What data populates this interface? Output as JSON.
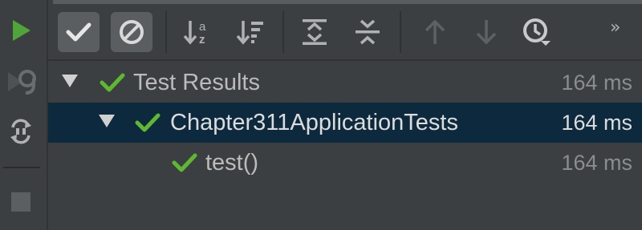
{
  "colors": {
    "background": "#3c3f41",
    "selected_row": "#0d293e",
    "pass_green": "#5fb832",
    "run_green": "#4fa53a",
    "icon_gray": "#afb1b3",
    "muted_text": "#8a8c8e"
  },
  "left_toolbar": {
    "items": [
      {
        "name": "run-icon"
      },
      {
        "name": "rerun-failed-icon"
      },
      {
        "name": "toggle-auto-test-icon"
      },
      {
        "name": "stop-icon"
      }
    ]
  },
  "top_toolbar": {
    "more_label": "»",
    "buttons": [
      {
        "name": "show-passed-icon",
        "pressed": true
      },
      {
        "name": "show-ignored-icon",
        "pressed": true
      },
      {
        "name": "sort-alphabetically-icon"
      },
      {
        "name": "sort-by-duration-icon"
      },
      {
        "name": "expand-all-icon"
      },
      {
        "name": "collapse-all-icon"
      },
      {
        "name": "previous-failed-icon"
      },
      {
        "name": "next-failed-icon"
      },
      {
        "name": "test-history-icon"
      }
    ]
  },
  "tree": {
    "rows": [
      {
        "label": "Test Results",
        "duration": "164 ms",
        "level": 0,
        "expanded": true,
        "status": "passed",
        "selected": false
      },
      {
        "label": "Chapter311ApplicationTests",
        "duration": "164 ms",
        "level": 1,
        "expanded": true,
        "status": "passed",
        "selected": true
      },
      {
        "label": "test()",
        "duration": "164 ms",
        "level": 2,
        "expanded": false,
        "status": "passed",
        "selected": false
      }
    ]
  }
}
